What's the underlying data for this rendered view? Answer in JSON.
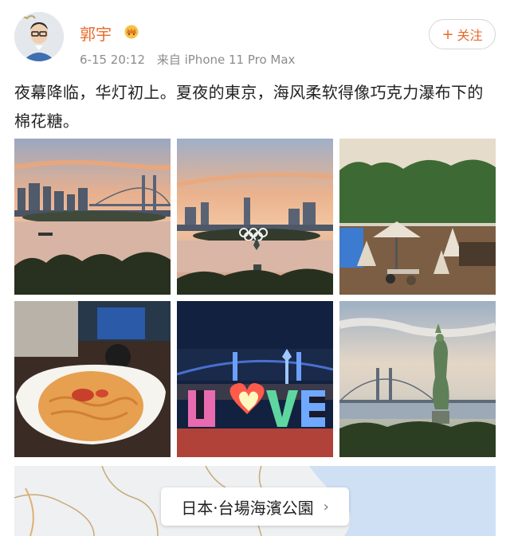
{
  "user": {
    "name": "郭宇",
    "verified_badge": "crown-badge-icon",
    "timestamp": "6-15 20:12",
    "source": "来自 iPhone 11 Pro Max"
  },
  "follow_button": {
    "icon": "+",
    "label": "关注"
  },
  "post_text": "夜幕降临，华灯初上。夏夜的東京，海风柔软得像巧克力瀑布下的棉花糖。",
  "photos": [
    {
      "subject": "sunset-rainbow-bridge"
    },
    {
      "subject": "olympic-rings-statue"
    },
    {
      "subject": "terrace-cafe"
    },
    {
      "subject": "pasta-dish"
    },
    {
      "subject": "love-sign-night"
    },
    {
      "subject": "statue-of-liberty-bridge"
    }
  ],
  "photo6_caption": "",
  "location": {
    "text": "日本·台場海濱公園",
    "chevron": "›"
  },
  "colors": {
    "accent": "#e86a2a",
    "meta": "#8c8c8c"
  }
}
